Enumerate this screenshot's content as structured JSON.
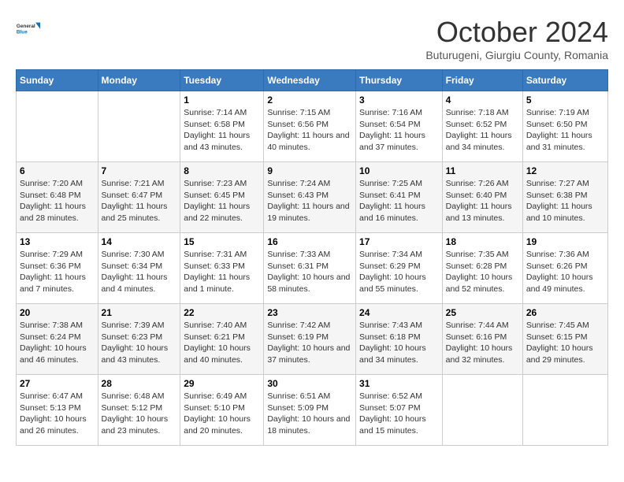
{
  "header": {
    "logo_general": "General",
    "logo_blue": "Blue",
    "month_title": "October 2024",
    "subtitle": "Buturugeni, Giurgiu County, Romania"
  },
  "days_of_week": [
    "Sunday",
    "Monday",
    "Tuesday",
    "Wednesday",
    "Thursday",
    "Friday",
    "Saturday"
  ],
  "weeks": [
    [
      null,
      null,
      {
        "day": 1,
        "sunrise": "7:14 AM",
        "sunset": "6:58 PM",
        "daylight": "11 hours and 43 minutes."
      },
      {
        "day": 2,
        "sunrise": "7:15 AM",
        "sunset": "6:56 PM",
        "daylight": "11 hours and 40 minutes."
      },
      {
        "day": 3,
        "sunrise": "7:16 AM",
        "sunset": "6:54 PM",
        "daylight": "11 hours and 37 minutes."
      },
      {
        "day": 4,
        "sunrise": "7:18 AM",
        "sunset": "6:52 PM",
        "daylight": "11 hours and 34 minutes."
      },
      {
        "day": 5,
        "sunrise": "7:19 AM",
        "sunset": "6:50 PM",
        "daylight": "11 hours and 31 minutes."
      }
    ],
    [
      {
        "day": 6,
        "sunrise": "7:20 AM",
        "sunset": "6:48 PM",
        "daylight": "11 hours and 28 minutes."
      },
      {
        "day": 7,
        "sunrise": "7:21 AM",
        "sunset": "6:47 PM",
        "daylight": "11 hours and 25 minutes."
      },
      {
        "day": 8,
        "sunrise": "7:23 AM",
        "sunset": "6:45 PM",
        "daylight": "11 hours and 22 minutes."
      },
      {
        "day": 9,
        "sunrise": "7:24 AM",
        "sunset": "6:43 PM",
        "daylight": "11 hours and 19 minutes."
      },
      {
        "day": 10,
        "sunrise": "7:25 AM",
        "sunset": "6:41 PM",
        "daylight": "11 hours and 16 minutes."
      },
      {
        "day": 11,
        "sunrise": "7:26 AM",
        "sunset": "6:40 PM",
        "daylight": "11 hours and 13 minutes."
      },
      {
        "day": 12,
        "sunrise": "7:27 AM",
        "sunset": "6:38 PM",
        "daylight": "11 hours and 10 minutes."
      }
    ],
    [
      {
        "day": 13,
        "sunrise": "7:29 AM",
        "sunset": "6:36 PM",
        "daylight": "11 hours and 7 minutes."
      },
      {
        "day": 14,
        "sunrise": "7:30 AM",
        "sunset": "6:34 PM",
        "daylight": "11 hours and 4 minutes."
      },
      {
        "day": 15,
        "sunrise": "7:31 AM",
        "sunset": "6:33 PM",
        "daylight": "11 hours and 1 minute."
      },
      {
        "day": 16,
        "sunrise": "7:33 AM",
        "sunset": "6:31 PM",
        "daylight": "10 hours and 58 minutes."
      },
      {
        "day": 17,
        "sunrise": "7:34 AM",
        "sunset": "6:29 PM",
        "daylight": "10 hours and 55 minutes."
      },
      {
        "day": 18,
        "sunrise": "7:35 AM",
        "sunset": "6:28 PM",
        "daylight": "10 hours and 52 minutes."
      },
      {
        "day": 19,
        "sunrise": "7:36 AM",
        "sunset": "6:26 PM",
        "daylight": "10 hours and 49 minutes."
      }
    ],
    [
      {
        "day": 20,
        "sunrise": "7:38 AM",
        "sunset": "6:24 PM",
        "daylight": "10 hours and 46 minutes."
      },
      {
        "day": 21,
        "sunrise": "7:39 AM",
        "sunset": "6:23 PM",
        "daylight": "10 hours and 43 minutes."
      },
      {
        "day": 22,
        "sunrise": "7:40 AM",
        "sunset": "6:21 PM",
        "daylight": "10 hours and 40 minutes."
      },
      {
        "day": 23,
        "sunrise": "7:42 AM",
        "sunset": "6:19 PM",
        "daylight": "10 hours and 37 minutes."
      },
      {
        "day": 24,
        "sunrise": "7:43 AM",
        "sunset": "6:18 PM",
        "daylight": "10 hours and 34 minutes."
      },
      {
        "day": 25,
        "sunrise": "7:44 AM",
        "sunset": "6:16 PM",
        "daylight": "10 hours and 32 minutes."
      },
      {
        "day": 26,
        "sunrise": "7:45 AM",
        "sunset": "6:15 PM",
        "daylight": "10 hours and 29 minutes."
      }
    ],
    [
      {
        "day": 27,
        "sunrise": "6:47 AM",
        "sunset": "5:13 PM",
        "daylight": "10 hours and 26 minutes."
      },
      {
        "day": 28,
        "sunrise": "6:48 AM",
        "sunset": "5:12 PM",
        "daylight": "10 hours and 23 minutes."
      },
      {
        "day": 29,
        "sunrise": "6:49 AM",
        "sunset": "5:10 PM",
        "daylight": "10 hours and 20 minutes."
      },
      {
        "day": 30,
        "sunrise": "6:51 AM",
        "sunset": "5:09 PM",
        "daylight": "10 hours and 18 minutes."
      },
      {
        "day": 31,
        "sunrise": "6:52 AM",
        "sunset": "5:07 PM",
        "daylight": "10 hours and 15 minutes."
      },
      null,
      null
    ]
  ]
}
